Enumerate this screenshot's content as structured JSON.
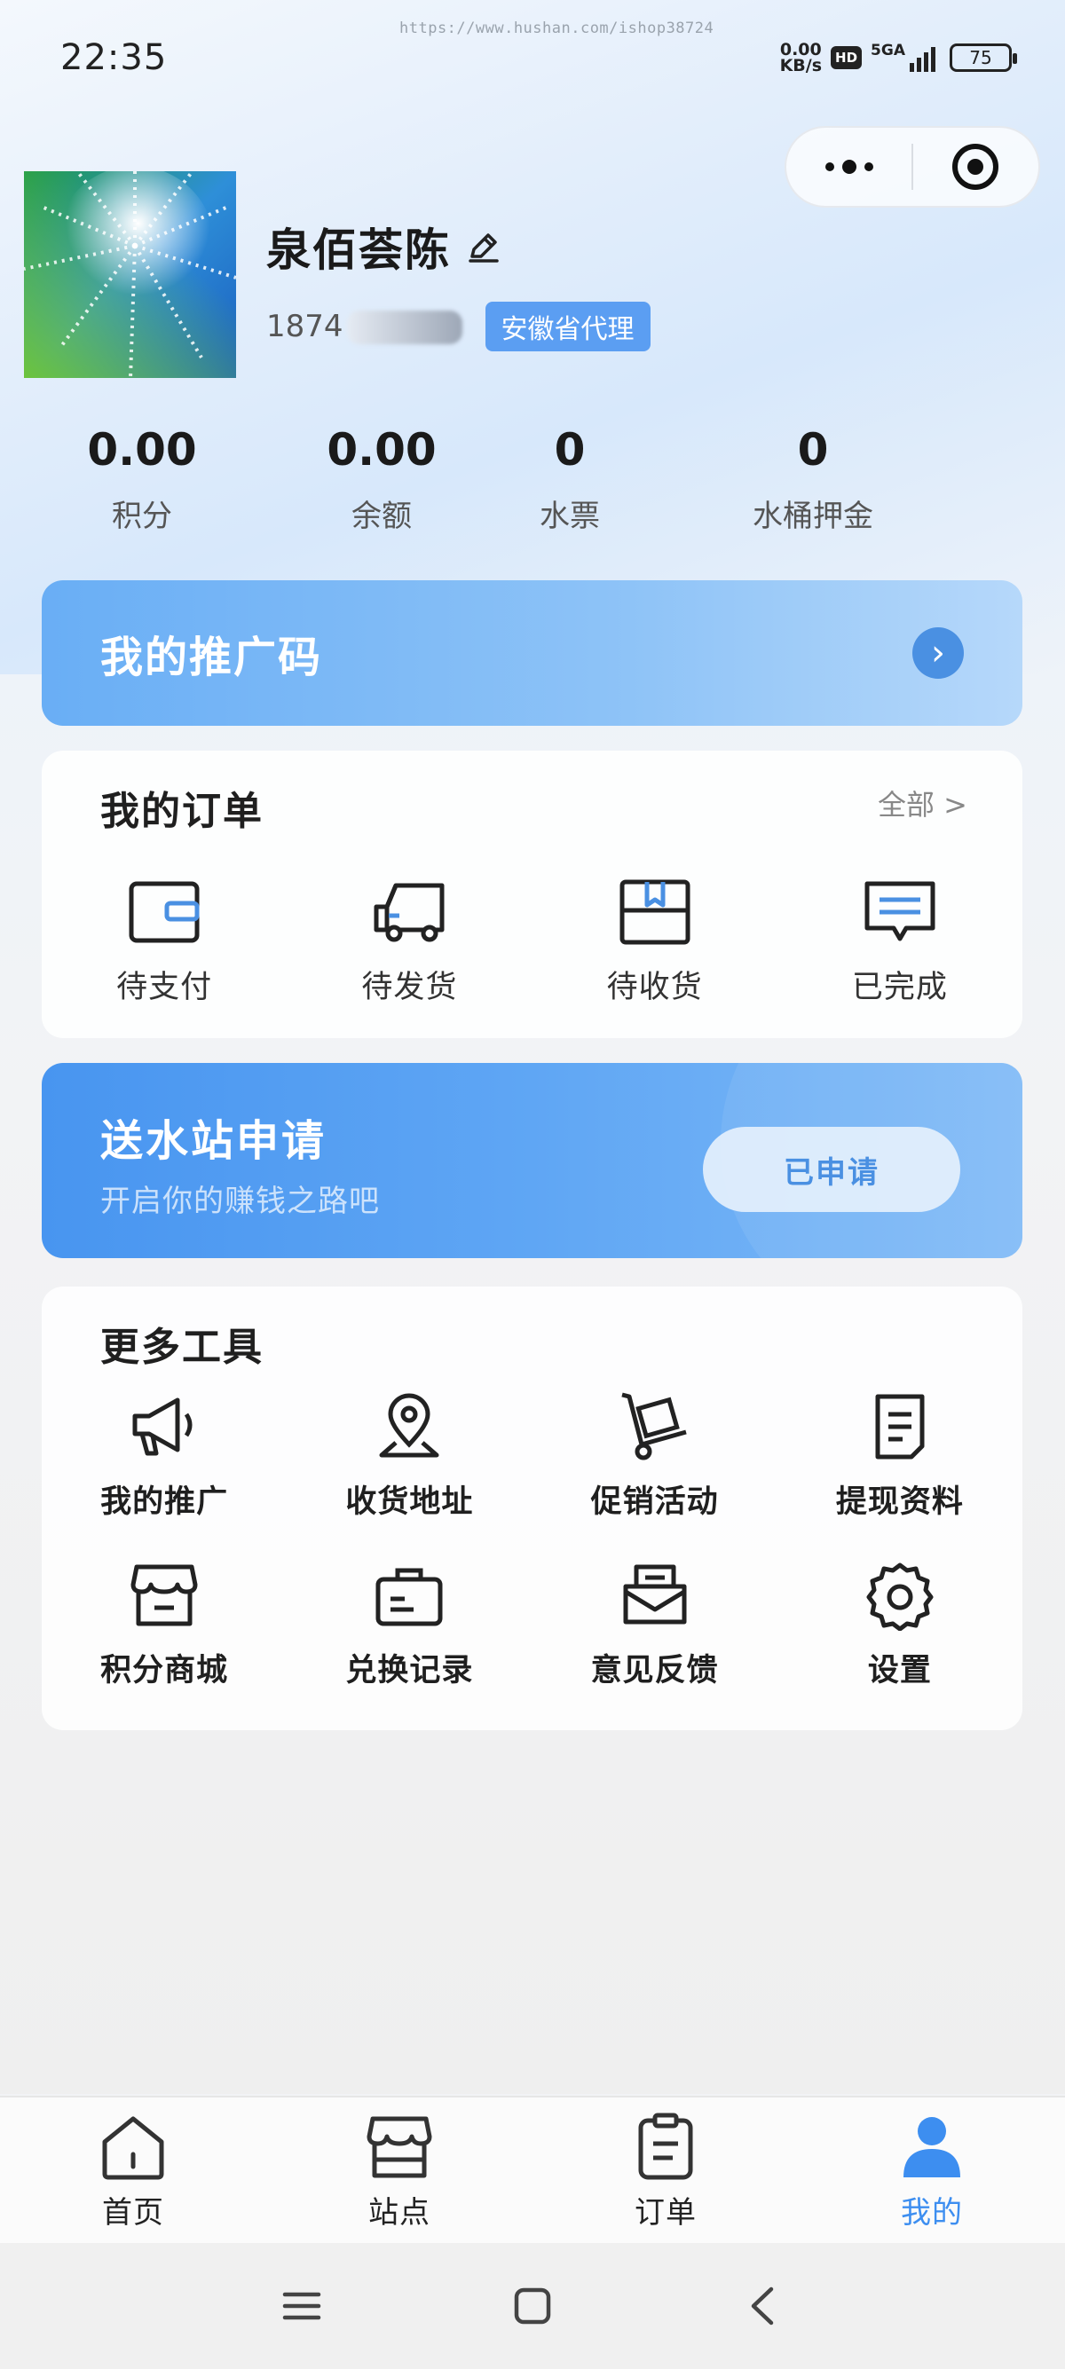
{
  "status_bar": {
    "time": "22:35",
    "net_speed_value": "0.00",
    "net_speed_unit": "KB/s",
    "hd_label": "HD",
    "signal_label": "5GA",
    "battery": "75"
  },
  "watermark": "https://www.hushan.com/ishop38724",
  "capsule": {
    "more_icon": "more-dots-icon",
    "close_icon": "target-icon"
  },
  "profile": {
    "name": "泉佰荟陈",
    "phone": "1874",
    "badge": "安徽省代理"
  },
  "stats": [
    {
      "value": "0.00",
      "label": "积分"
    },
    {
      "value": "0.00",
      "label": "余额"
    },
    {
      "value": "0",
      "label": "水票"
    },
    {
      "value": "0",
      "label": "水桶押金"
    }
  ],
  "promo": {
    "title": "我的推广码",
    "arrow": "›"
  },
  "orders": {
    "title": "我的订单",
    "view_all": "全部 >",
    "items": [
      {
        "label": "待支付",
        "icon": "wallet-icon"
      },
      {
        "label": "待发货",
        "icon": "truck-icon"
      },
      {
        "label": "待收货",
        "icon": "box-icon"
      },
      {
        "label": "已完成",
        "icon": "message-icon"
      }
    ]
  },
  "station": {
    "title": "送水站申请",
    "subtitle": "开启你的赚钱之路吧",
    "button": "已申请"
  },
  "tools": {
    "title": "更多工具",
    "items": [
      {
        "label": "我的推广",
        "icon": "megaphone-icon"
      },
      {
        "label": "收货地址",
        "icon": "location-pin-icon"
      },
      {
        "label": "促销活动",
        "icon": "hand-truck-icon"
      },
      {
        "label": "提现资料",
        "icon": "document-icon"
      },
      {
        "label": "积分商城",
        "icon": "store-icon"
      },
      {
        "label": "兑换记录",
        "icon": "briefcase-icon"
      },
      {
        "label": "意见反馈",
        "icon": "feedback-mail-icon"
      },
      {
        "label": "设置",
        "icon": "gear-icon"
      }
    ]
  },
  "tabbar": {
    "items": [
      {
        "label": "首页",
        "icon": "home-icon"
      },
      {
        "label": "站点",
        "icon": "shop-icon"
      },
      {
        "label": "订单",
        "icon": "clipboard-icon"
      },
      {
        "label": "我的",
        "icon": "user-icon",
        "active": true
      }
    ],
    "active_color": "#3d8ef0"
  },
  "colors": {
    "accent": "#4a90e2",
    "badge_bg": "#5b9ef2",
    "promo_gradient_start": "#69aef5",
    "station_gradient_start": "#4895f0"
  }
}
